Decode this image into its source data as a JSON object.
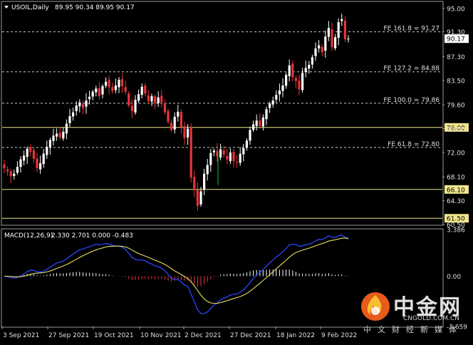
{
  "header": {
    "symbol": "USOIL,Daily",
    "ohlc": "89.95 90.34 89.95 90.17"
  },
  "macd_header": {
    "label": "MACD(12,26,9)",
    "values": "2.330 2.701 0.000 -0.483"
  },
  "logo": {
    "name": "中金网",
    "url": "CNGOLD.COM.CN",
    "tagline": "中文财经新媒体"
  },
  "colors": {
    "background": "#000000",
    "up_candle": "#ffffff",
    "down_candle": "#e8343a",
    "level_line": "#f0e68c",
    "fib_line": "#c8c8c8",
    "macd_hist_pos": "#ffffff",
    "macd_hist_neg": "#e8343a",
    "macd_signal": "#e8e060",
    "macd_line": "#2a44ff",
    "current_price_tag": "#ffffff"
  },
  "chart_data": [
    {
      "type": "candlestick",
      "title": "USOIL,Daily",
      "ylim": [
        60.5,
        96.0
      ],
      "y_ticks": [
        "95.00",
        "91.30",
        "87.30",
        "83.50",
        "79.60",
        "75.80",
        "72.00",
        "68.10",
        "64.30",
        "60.50"
      ],
      "current_price": "90.17",
      "horizontal_levels": [
        {
          "label": "76.00",
          "value": 76.0
        },
        {
          "label": "66.10",
          "value": 66.1
        },
        {
          "label": "61.50",
          "value": 61.5
        }
      ],
      "fib_levels": [
        {
          "label": "FE 161.8 = 91.27",
          "value": 91.27
        },
        {
          "label": "FE 127.2 = 84.88",
          "value": 84.88
        },
        {
          "label": "FE 100.0 = 79.86",
          "value": 79.86
        },
        {
          "label": "FE 61.8 = 72.80",
          "value": 72.8
        }
      ],
      "x_tick_labels": [
        "3 Sep 2021",
        "27 Sep 2021",
        "19 Oct 2021",
        "10 Nov 2021",
        "2 Dec 2021",
        "27 Dec 2021",
        "18 Jan 2022",
        "9 Feb 2022"
      ],
      "close_path": [
        69.5,
        69.0,
        68.2,
        68.6,
        69.7,
        70.9,
        71.5,
        72.6,
        72.1,
        71.0,
        69.5,
        70.3,
        71.8,
        72.9,
        74.0,
        74.7,
        75.0,
        74.4,
        75.3,
        76.6,
        77.8,
        78.4,
        79.5,
        80.0,
        79.1,
        80.3,
        80.9,
        81.7,
        82.2,
        81.0,
        82.6,
        83.3,
        82.4,
        81.8,
        82.7,
        83.6,
        82.6,
        81.7,
        79.5,
        78.6,
        80.4,
        81.3,
        82.5,
        81.4,
        80.2,
        81.0,
        79.9,
        80.8,
        80.0,
        78.4,
        76.9,
        75.6,
        77.7,
        78.5,
        76.1,
        74.3,
        75.8,
        68.0,
        66.0,
        63.5,
        65.8,
        68.6,
        70.0,
        71.9,
        72.3,
        71.4,
        72.5,
        71.7,
        70.9,
        72.0,
        70.6,
        70.4,
        71.8,
        72.7,
        73.9,
        75.6,
        76.5,
        77.1,
        76.2,
        77.6,
        78.9,
        79.8,
        80.3,
        81.2,
        81.9,
        82.7,
        84.4,
        85.9,
        84.0,
        83.4,
        82.1,
        84.7,
        85.5,
        86.0,
        87.2,
        88.6,
        89.1,
        88.0,
        90.5,
        91.9,
        88.8,
        90.4,
        92.8,
        93.3,
        90.1,
        90.17
      ],
      "series": [
        {
          "name": "FE 161.8",
          "values": [
            91.27
          ]
        }
      ]
    },
    {
      "type": "line",
      "title": "MACD(12,26,9)",
      "ylim": [
        -3.659,
        3.386
      ],
      "y_ticks": [
        "3.386",
        "0.00",
        "-3.659"
      ],
      "values_shown": {
        "main": 2.33,
        "signal": 2.701,
        "hist_a": 0.0,
        "hist_b": -0.483
      },
      "series": []
    }
  ]
}
